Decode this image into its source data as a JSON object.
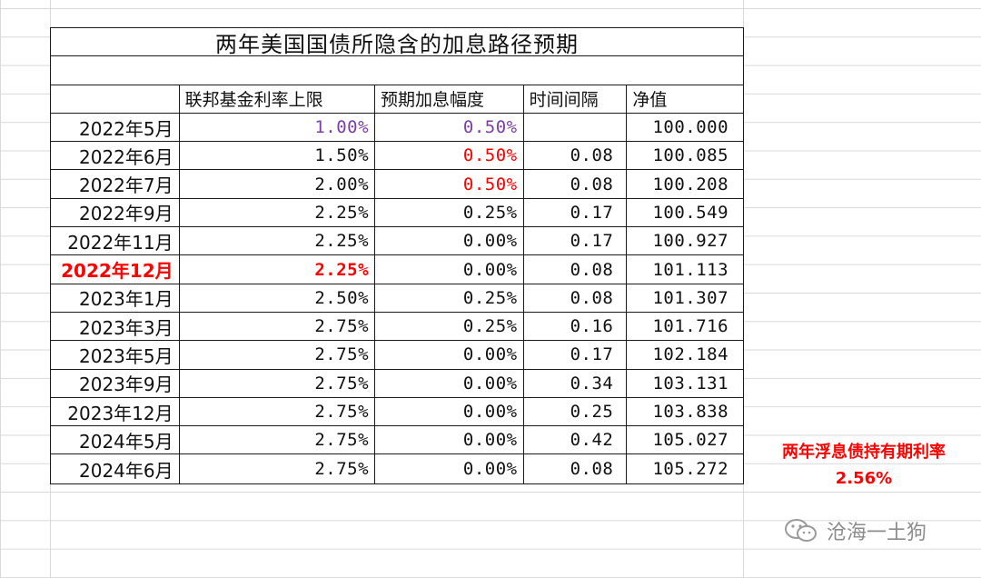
{
  "title": "两年美国国债所隐含的加息路径预期",
  "headers": [
    "",
    "联邦基金利率上限",
    "预期加息幅度",
    "时间间隔",
    "净值"
  ],
  "rows": [
    {
      "date": "2022年5月",
      "rate": "1.00%",
      "hike": "0.50%",
      "interval": "",
      "nav": "100.000",
      "rate_color": "purple",
      "hike_color": "purple",
      "highlight": false
    },
    {
      "date": "2022年6月",
      "rate": "1.50%",
      "hike": "0.50%",
      "interval": "0.08",
      "nav": "100.085",
      "rate_color": "",
      "hike_color": "red",
      "highlight": false
    },
    {
      "date": "2022年7月",
      "rate": "2.00%",
      "hike": "0.50%",
      "interval": "0.08",
      "nav": "100.208",
      "rate_color": "",
      "hike_color": "red",
      "highlight": false
    },
    {
      "date": "2022年9月",
      "rate": "2.25%",
      "hike": "0.25%",
      "interval": "0.17",
      "nav": "100.549",
      "rate_color": "",
      "hike_color": "",
      "highlight": false
    },
    {
      "date": "2022年11月",
      "rate": "2.25%",
      "hike": "0.00%",
      "interval": "0.17",
      "nav": "100.927",
      "rate_color": "",
      "hike_color": "",
      "highlight": false
    },
    {
      "date": "2022年12月",
      "rate": "2.25%",
      "hike": "0.00%",
      "interval": "0.08",
      "nav": "101.113",
      "rate_color": "",
      "hike_color": "",
      "highlight": true
    },
    {
      "date": "2023年1月",
      "rate": "2.50%",
      "hike": "0.25%",
      "interval": "0.08",
      "nav": "101.307",
      "rate_color": "",
      "hike_color": "",
      "highlight": false
    },
    {
      "date": "2023年3月",
      "rate": "2.75%",
      "hike": "0.25%",
      "interval": "0.16",
      "nav": "101.716",
      "rate_color": "",
      "hike_color": "",
      "highlight": false
    },
    {
      "date": "2023年5月",
      "rate": "2.75%",
      "hike": "0.00%",
      "interval": "0.17",
      "nav": "102.184",
      "rate_color": "",
      "hike_color": "",
      "highlight": false
    },
    {
      "date": "2023年9月",
      "rate": "2.75%",
      "hike": "0.00%",
      "interval": "0.34",
      "nav": "103.131",
      "rate_color": "",
      "hike_color": "",
      "highlight": false
    },
    {
      "date": "2023年12月",
      "rate": "2.75%",
      "hike": "0.00%",
      "interval": "0.25",
      "nav": "103.838",
      "rate_color": "",
      "hike_color": "",
      "highlight": false
    },
    {
      "date": "2024年5月",
      "rate": "2.75%",
      "hike": "0.00%",
      "interval": "0.42",
      "nav": "105.027",
      "rate_color": "",
      "hike_color": "",
      "highlight": false
    },
    {
      "date": "2024年6月",
      "rate": "2.75%",
      "hike": "0.00%",
      "interval": "0.08",
      "nav": "105.272",
      "rate_color": "",
      "hike_color": "",
      "highlight": false
    }
  ],
  "note": {
    "label": "两年浮息债持有期利率",
    "value": "2.56%"
  },
  "watermark": {
    "text": "沧海一土狗",
    "icon": "wechat-icon"
  },
  "colors": {
    "purple": "#7b3fa6",
    "red": "#ff0000"
  }
}
